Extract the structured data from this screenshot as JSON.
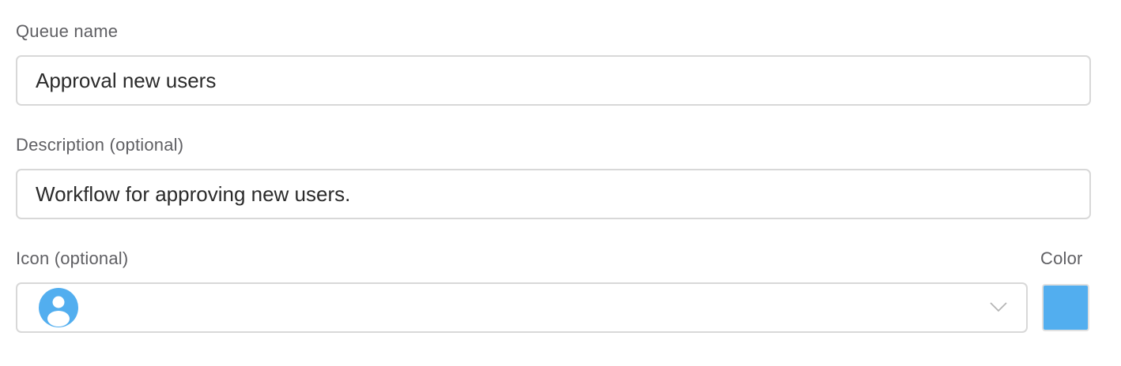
{
  "queue_name": {
    "label": "Queue name",
    "value": "Approval new users"
  },
  "description": {
    "label": "Description (optional)",
    "value": "Workflow for approving new users."
  },
  "icon": {
    "label": "Icon (optional)",
    "selected_icon": "user-circle-icon",
    "dropdown_icon": "chevron-down-icon"
  },
  "color": {
    "label": "Color",
    "value": "#52aeef"
  }
}
